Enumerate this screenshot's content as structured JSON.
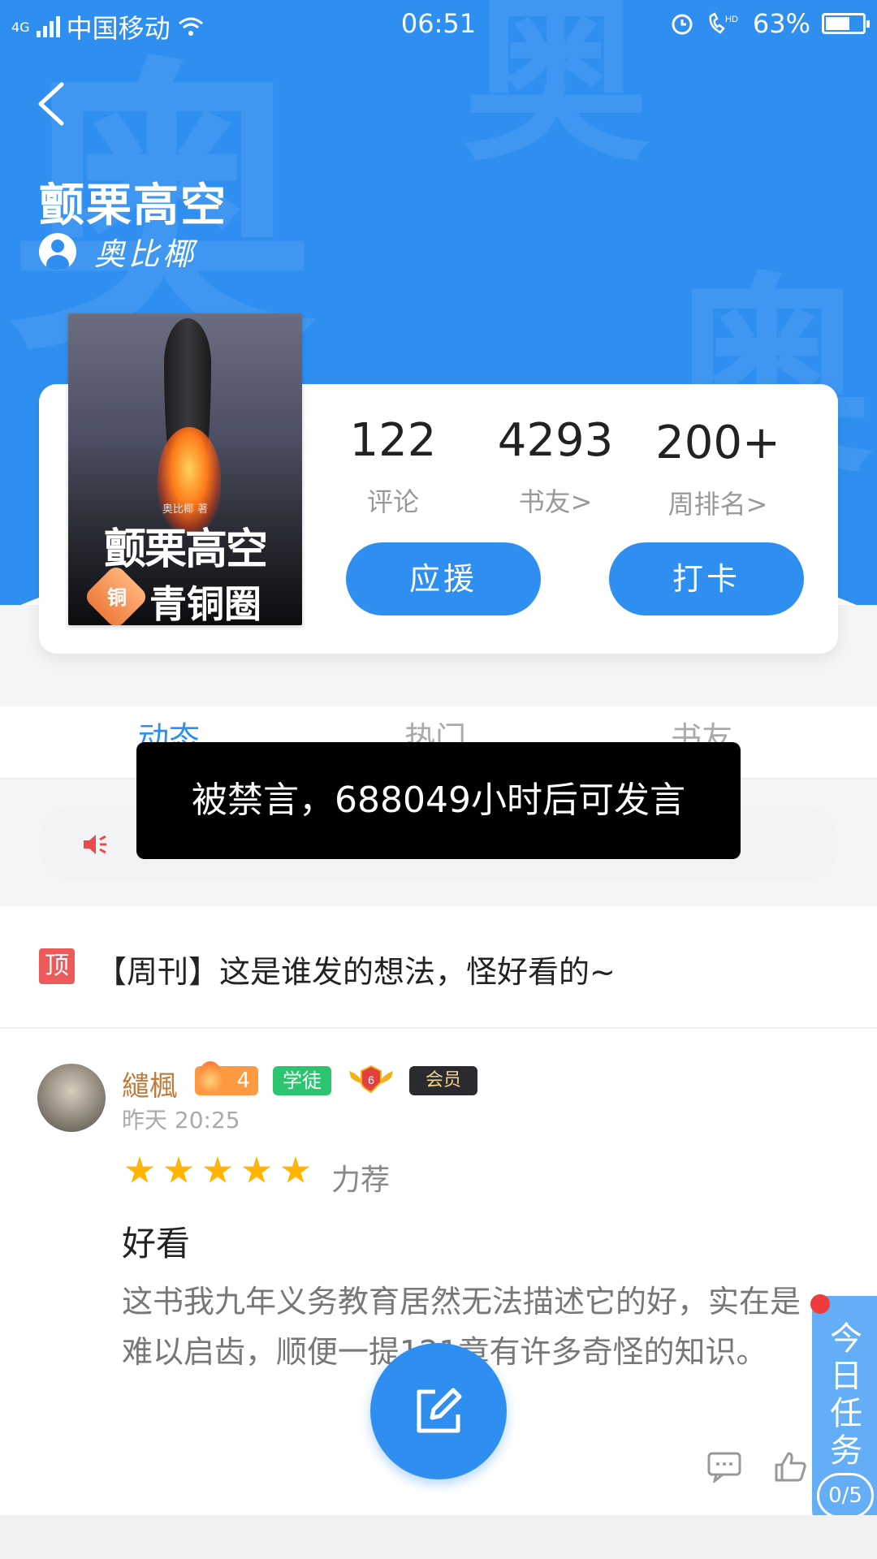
{
  "status_bar": {
    "network": "4G",
    "carrier": "中国移动",
    "time": "06:51",
    "battery": "63%",
    "battery_level": 0.63
  },
  "header": {
    "title": "颤栗高空",
    "author": "奥比椰",
    "watermark_char": "奥"
  },
  "cover": {
    "small_byline": "奥比椰 著",
    "title": "颤栗高空",
    "badge": "铜",
    "circle_label": "青铜圈"
  },
  "stats": [
    {
      "value": "122",
      "label": "评论"
    },
    {
      "value": "4293",
      "label": "书友>"
    },
    {
      "value": "200+",
      "label": "周排名>"
    }
  ],
  "actions": {
    "support": "应援",
    "checkin": "打卡"
  },
  "tabs": [
    "动态",
    "热门",
    "书友"
  ],
  "toast": "被禁言，688049小时后可发言",
  "pinned": {
    "tag": "顶",
    "text": "【周刊】这是谁发的想法，怪好看的~"
  },
  "comment": {
    "user": "繾楓",
    "fire_level": "4",
    "role_badge": "学徒",
    "rank_badge": "6",
    "vip_badge": "会员",
    "time": "昨天 20:25",
    "rating_stars": 5,
    "rating_label": "力荐",
    "title": "好看",
    "body": "这书我九年义务教育居然无法描述它的好，实在是难以启齿，顺便一提121章有许多奇怪的知识。"
  },
  "daily_task": {
    "label": "今日任务",
    "progress": "0/5"
  },
  "colors": {
    "primary": "#2f8ff0",
    "toast_bg": "#000000",
    "pinned_tag": "#ec5a5a",
    "star": "#ffb400"
  }
}
